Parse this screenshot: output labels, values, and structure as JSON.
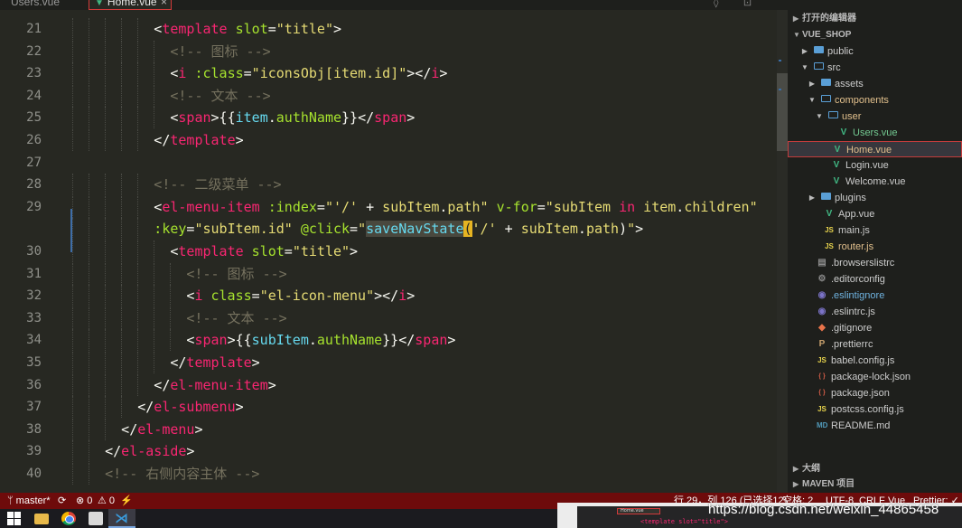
{
  "tabs": [
    {
      "label": "Users.vue",
      "active": false
    },
    {
      "label": "Home.vue",
      "active": true,
      "close": "×"
    }
  ],
  "top_actions": "◊ ⊡ ⋯",
  "editor": {
    "lines": [
      {
        "num": "21",
        "indent": 5,
        "tokens": [
          {
            "t": "<",
            "c": "t-p"
          },
          {
            "t": "template",
            "c": "t-tag"
          },
          {
            "t": " slot",
            "c": "t-attr"
          },
          {
            "t": "=",
            "c": "t-p"
          },
          {
            "t": "\"title\"",
            "c": "t-str"
          },
          {
            "t": ">",
            "c": "t-p"
          }
        ]
      },
      {
        "num": "22",
        "indent": 6,
        "tokens": [
          {
            "t": "<!-- 图标 -->",
            "c": "t-com"
          }
        ]
      },
      {
        "num": "23",
        "indent": 6,
        "tokens": [
          {
            "t": "<",
            "c": "t-p"
          },
          {
            "t": "i",
            "c": "t-tag"
          },
          {
            "t": " :class",
            "c": "t-attr"
          },
          {
            "t": "=",
            "c": "t-p"
          },
          {
            "t": "\"iconsObj[item.id]\"",
            "c": "t-str"
          },
          {
            "t": "></",
            "c": "t-p"
          },
          {
            "t": "i",
            "c": "t-tag"
          },
          {
            "t": ">",
            "c": "t-p"
          }
        ]
      },
      {
        "num": "24",
        "indent": 6,
        "tokens": [
          {
            "t": "<!-- 文本 -->",
            "c": "t-com"
          }
        ]
      },
      {
        "num": "25",
        "indent": 6,
        "tokens": [
          {
            "t": "<",
            "c": "t-p"
          },
          {
            "t": "span",
            "c": "t-tag"
          },
          {
            "t": ">{{",
            "c": "t-p"
          },
          {
            "t": "item",
            "c": "t-bind"
          },
          {
            "t": ".",
            "c": "t-p"
          },
          {
            "t": "authName",
            "c": "t-attr"
          },
          {
            "t": "}}</",
            "c": "t-p"
          },
          {
            "t": "span",
            "c": "t-tag"
          },
          {
            "t": ">",
            "c": "t-p"
          }
        ]
      },
      {
        "num": "26",
        "indent": 5,
        "tokens": [
          {
            "t": "</",
            "c": "t-p"
          },
          {
            "t": "template",
            "c": "t-tag"
          },
          {
            "t": ">",
            "c": "t-p"
          }
        ]
      },
      {
        "num": "27",
        "indent": 0,
        "tokens": []
      },
      {
        "num": "28",
        "indent": 5,
        "tokens": [
          {
            "t": "<!-- 二级菜单 -->",
            "c": "t-com"
          }
        ]
      },
      {
        "num": "29",
        "indent": 5,
        "tokens": [
          {
            "t": "<",
            "c": "t-p"
          },
          {
            "t": "el-menu-item",
            "c": "t-tag"
          },
          {
            "t": " :index",
            "c": "t-attr"
          },
          {
            "t": "=",
            "c": "t-p"
          },
          {
            "t": "\"",
            "c": "t-str"
          },
          {
            "t": "'/'",
            "c": "t-str"
          },
          {
            "t": " + ",
            "c": "t-p"
          },
          {
            "t": "subItem",
            "c": "t-str"
          },
          {
            "t": ".",
            "c": "t-p"
          },
          {
            "t": "path",
            "c": "t-str"
          },
          {
            "t": "\"",
            "c": "t-str"
          },
          {
            "t": " v-for",
            "c": "t-attr"
          },
          {
            "t": "=",
            "c": "t-p"
          },
          {
            "t": "\"",
            "c": "t-str"
          },
          {
            "t": "subItem ",
            "c": "t-str"
          },
          {
            "t": "in",
            "c": "t-tag"
          },
          {
            "t": " item",
            "c": "t-str"
          },
          {
            "t": ".",
            "c": "t-p"
          },
          {
            "t": "children",
            "c": "t-str"
          },
          {
            "t": "\"",
            "c": "t-str"
          }
        ]
      },
      {
        "num": "",
        "indent": 5,
        "tokens": [
          {
            "t": ":key",
            "c": "t-attr"
          },
          {
            "t": "=",
            "c": "t-p"
          },
          {
            "t": "\"subItem.id\"",
            "c": "t-str"
          },
          {
            "t": " @click",
            "c": "t-attr"
          },
          {
            "t": "=",
            "c": "t-p"
          },
          {
            "t": "\"",
            "c": "t-str"
          },
          {
            "t": "saveNavState",
            "c": "t-bind sel"
          },
          {
            "t": "(",
            "c": "match"
          },
          {
            "t": "'/'",
            "c": "t-str"
          },
          {
            "t": " + ",
            "c": "t-p"
          },
          {
            "t": "subItem",
            "c": "t-str"
          },
          {
            "t": ".",
            "c": "t-p"
          },
          {
            "t": "path",
            "c": "t-str"
          },
          {
            "t": ")",
            "c": "t-p"
          },
          {
            "t": "\"",
            "c": "t-str"
          },
          {
            "t": ">",
            "c": "t-p"
          }
        ]
      },
      {
        "num": "30",
        "indent": 6,
        "tokens": [
          {
            "t": "<",
            "c": "t-p"
          },
          {
            "t": "template",
            "c": "t-tag"
          },
          {
            "t": " slot",
            "c": "t-attr"
          },
          {
            "t": "=",
            "c": "t-p"
          },
          {
            "t": "\"title\"",
            "c": "t-str"
          },
          {
            "t": ">",
            "c": "t-p"
          }
        ]
      },
      {
        "num": "31",
        "indent": 7,
        "tokens": [
          {
            "t": "<!-- 图标 -->",
            "c": "t-com"
          }
        ]
      },
      {
        "num": "32",
        "indent": 7,
        "tokens": [
          {
            "t": "<",
            "c": "t-p"
          },
          {
            "t": "i",
            "c": "t-tag"
          },
          {
            "t": " class",
            "c": "t-attr"
          },
          {
            "t": "=",
            "c": "t-p"
          },
          {
            "t": "\"el-icon-menu\"",
            "c": "t-str"
          },
          {
            "t": "></",
            "c": "t-p"
          },
          {
            "t": "i",
            "c": "t-tag"
          },
          {
            "t": ">",
            "c": "t-p"
          }
        ]
      },
      {
        "num": "33",
        "indent": 7,
        "tokens": [
          {
            "t": "<!-- 文本 -->",
            "c": "t-com"
          }
        ]
      },
      {
        "num": "34",
        "indent": 7,
        "tokens": [
          {
            "t": "<",
            "c": "t-p"
          },
          {
            "t": "span",
            "c": "t-tag"
          },
          {
            "t": ">{{",
            "c": "t-p"
          },
          {
            "t": "subItem",
            "c": "t-bind"
          },
          {
            "t": ".",
            "c": "t-p"
          },
          {
            "t": "authName",
            "c": "t-attr"
          },
          {
            "t": "}}</",
            "c": "t-p"
          },
          {
            "t": "span",
            "c": "t-tag"
          },
          {
            "t": ">",
            "c": "t-p"
          }
        ]
      },
      {
        "num": "35",
        "indent": 6,
        "tokens": [
          {
            "t": "</",
            "c": "t-p"
          },
          {
            "t": "template",
            "c": "t-tag"
          },
          {
            "t": ">",
            "c": "t-p"
          }
        ]
      },
      {
        "num": "36",
        "indent": 5,
        "tokens": [
          {
            "t": "</",
            "c": "t-p"
          },
          {
            "t": "el-menu-item",
            "c": "t-tag"
          },
          {
            "t": ">",
            "c": "t-p"
          }
        ]
      },
      {
        "num": "37",
        "indent": 4,
        "tokens": [
          {
            "t": "</",
            "c": "t-p"
          },
          {
            "t": "el-submenu",
            "c": "t-tag"
          },
          {
            "t": ">",
            "c": "t-p"
          }
        ]
      },
      {
        "num": "38",
        "indent": 3,
        "tokens": [
          {
            "t": "</",
            "c": "t-p"
          },
          {
            "t": "el-menu",
            "c": "t-tag"
          },
          {
            "t": ">",
            "c": "t-p"
          }
        ]
      },
      {
        "num": "39",
        "indent": 2,
        "tokens": [
          {
            "t": "</",
            "c": "t-p"
          },
          {
            "t": "el-aside",
            "c": "t-tag"
          },
          {
            "t": ">",
            "c": "t-p"
          }
        ]
      },
      {
        "num": "40",
        "indent": 2,
        "tokens": [
          {
            "t": "<!-- 右侧内容主体 -->",
            "c": "t-com"
          }
        ]
      }
    ]
  },
  "explorer": {
    "sections": {
      "open_editors": "打开的编辑器",
      "project": "VUE_SHOP",
      "outline": "大纲",
      "maven": "MAVEN 项目"
    },
    "tree": [
      {
        "label": "public",
        "depth": 0,
        "kind": "folder",
        "arrow": "▶"
      },
      {
        "label": "src",
        "depth": 0,
        "kind": "folder-open",
        "arrow": "▼"
      },
      {
        "label": "assets",
        "depth": 1,
        "kind": "folder",
        "arrow": "▶"
      },
      {
        "label": "components",
        "depth": 1,
        "kind": "folder-open",
        "arrow": "▼",
        "tone": "orange"
      },
      {
        "label": "user",
        "depth": 2,
        "kind": "folder-open",
        "arrow": "▼",
        "tone": "orange"
      },
      {
        "label": "Users.vue",
        "depth": 3,
        "kind": "vue",
        "tone": "git-added"
      },
      {
        "label": "Home.vue",
        "depth": 2,
        "kind": "vue",
        "tone": "orange",
        "active": true
      },
      {
        "label": "Login.vue",
        "depth": 2,
        "kind": "vue"
      },
      {
        "label": "Welcome.vue",
        "depth": 2,
        "kind": "vue"
      },
      {
        "label": "plugins",
        "depth": 1,
        "kind": "folder",
        "arrow": "▶"
      },
      {
        "label": "App.vue",
        "depth": 1,
        "kind": "vue"
      },
      {
        "label": "main.js",
        "depth": 1,
        "kind": "js"
      },
      {
        "label": "router.js",
        "depth": 1,
        "kind": "js",
        "tone": "orange"
      },
      {
        "label": ".browserslistrc",
        "depth": 0,
        "kind": "dot"
      },
      {
        "label": ".editorconfig",
        "depth": 0,
        "kind": "gear"
      },
      {
        "label": ".eslintignore",
        "depth": 0,
        "kind": "eslint",
        "tone": "blue"
      },
      {
        "label": ".eslintrc.js",
        "depth": 0,
        "kind": "eslint"
      },
      {
        "label": ".gitignore",
        "depth": 0,
        "kind": "git"
      },
      {
        "label": ".prettierrc",
        "depth": 0,
        "kind": "prettier"
      },
      {
        "label": "babel.config.js",
        "depth": 0,
        "kind": "js"
      },
      {
        "label": "package-lock.json",
        "depth": 0,
        "kind": "json"
      },
      {
        "label": "package.json",
        "depth": 0,
        "kind": "json"
      },
      {
        "label": "postcss.config.js",
        "depth": 0,
        "kind": "js"
      },
      {
        "label": "README.md",
        "depth": 0,
        "kind": "md"
      }
    ]
  },
  "statusbar": {
    "branch": "master*",
    "sync": "⟳",
    "errors": "⊗ 0",
    "warnings": "⚠ 0",
    "lightning": "⚡",
    "position": "行 29，列 126 (已选择12)",
    "spaces": "空格: 2",
    "encoding": "UTF-8",
    "eol": "CRLF",
    "language": "Vue",
    "formatter": "Prettier: ✓"
  },
  "taskbar": {
    "watermark": "https://blog.csdn.net/weixin_44865458",
    "preview_tab": "Home.vue",
    "preview_code": "<template slot=\"title\">"
  },
  "colors": {
    "accent": "#6e0b0b",
    "editor_bg": "#272822",
    "sidebar_bg": "#1e1f1c"
  }
}
